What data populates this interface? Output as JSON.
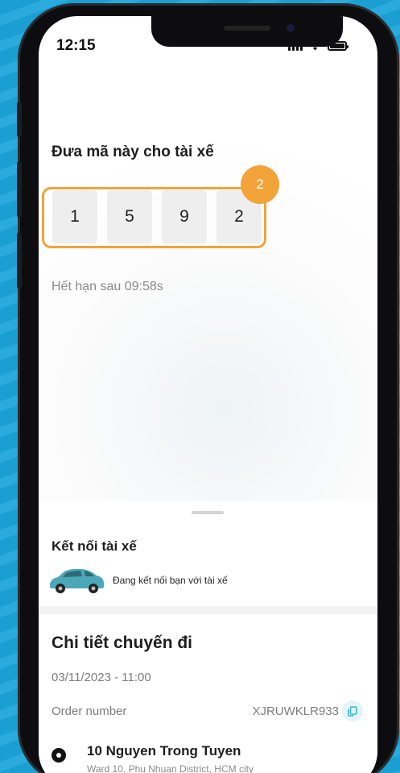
{
  "status_bar": {
    "time": "12:15"
  },
  "code_panel": {
    "title": "Đưa mã này cho tài xế",
    "digits": [
      "1",
      "5",
      "9",
      "2"
    ],
    "step_badge": "2",
    "expiry": "Hết hạn sau 09:58s",
    "highlight_color": "#f2a33a"
  },
  "connect": {
    "title": "Kết nối tài xế",
    "status": "Đang kết nối bạn với tài xế",
    "car_color": "#4aa8b8"
  },
  "trip": {
    "title": "Chi tiết chuyến đi",
    "datetime": "03/11/2023 - 11:00",
    "order_label": "Order number",
    "order_value": "XJRUWKLR933",
    "pickup_name": "10 Nguyen Trong Tuyen",
    "pickup_detail": "Ward 10, Phu Nhuan District, HCM city"
  },
  "icons": [
    "signal-icon",
    "wifi-icon",
    "battery-icon",
    "copy-icon",
    "location-pin-icon",
    "car-icon"
  ]
}
